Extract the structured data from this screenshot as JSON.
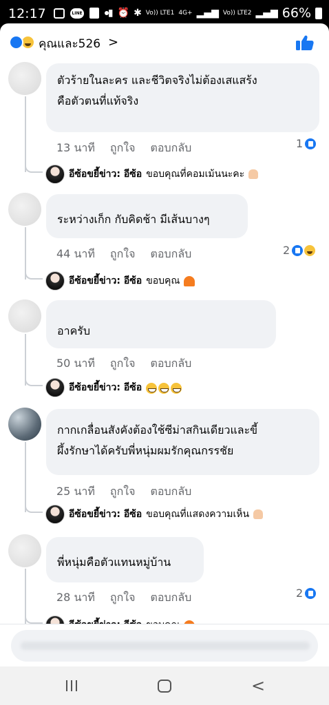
{
  "status_bar": {
    "time": "12:17",
    "network_labels": [
      "Vo)) LTE1",
      "4G+",
      "Vo)) LTE2"
    ],
    "battery": "66%"
  },
  "header": {
    "reactors": "คุณและ526",
    "chevron": ">"
  },
  "comments": [
    {
      "text_lines": [
        "ตัวร้ายในละคร และชีวิตจริงไม่ต้องเสแสร้ง",
        "คือตัวตนที่แท้จริง"
      ],
      "time": "13 นาที",
      "like": "ถูกใจ",
      "reply": "ตอบกลับ",
      "reaction_count": "1",
      "owner_reply": {
        "name": "อีซ้อขยี้ข่าว: อีซ้อ",
        "text": "ขอบคุณที่คอมเม้นนะคะ"
      }
    },
    {
      "text_lines": [
        "ระหว่างเก็ก กับคิดช้า มีเส้นบางๆ"
      ],
      "time": "44 นาที",
      "like": "ถูกใจ",
      "reply": "ตอบกลับ",
      "reaction_count": "2",
      "owner_reply": {
        "name": "อีซ้อขยี้ข่าว: อีซ้อ",
        "text": "ขอบคุณ"
      }
    },
    {
      "text_lines": [
        "อาครับ"
      ],
      "time": "50 นาที",
      "like": "ถูกใจ",
      "reply": "ตอบกลับ",
      "reaction_count": "",
      "owner_reply": {
        "name": "อีซ้อขยี้ข่าว: อีซ้อ",
        "text": ""
      }
    },
    {
      "text_lines": [
        "กากเกลื่อนสังคังต้องใช้ซีม่าสกินเดียวและขี้",
        "ผึ้งรักษาได้ครับพี่หนุ่มผมรักคุณกรรชัย"
      ],
      "time": "25 นาที",
      "like": "ถูกใจ",
      "reply": "ตอบกลับ",
      "reaction_count": "",
      "owner_reply": {
        "name": "อีซ้อขยี้ข่าว: อีซ้อ",
        "text": "ขอบคุณที่แสดงความเห็น"
      }
    },
    {
      "text_lines": [
        "พี่หนุ่มคือตัวแทนหมู่บ้าน"
      ],
      "time": "28 นาที",
      "like": "ถูกใจ",
      "reply": "ตอบกลับ",
      "reaction_count": "2",
      "owner_reply": {
        "name": "อีซ้อขยี้ข่าว: อีซ้อ",
        "text": "ขอบคุณ"
      }
    }
  ],
  "icons": {
    "like": "like-icon",
    "haha": "haha-icon",
    "nav_recent": "recent-apps-icon",
    "nav_home": "home-icon",
    "nav_back": "back-icon",
    "nav_back_glyph": "<"
  },
  "colors": {
    "accent": "#1877f2",
    "bubble": "#f0f2f5",
    "meta": "#65676b"
  }
}
